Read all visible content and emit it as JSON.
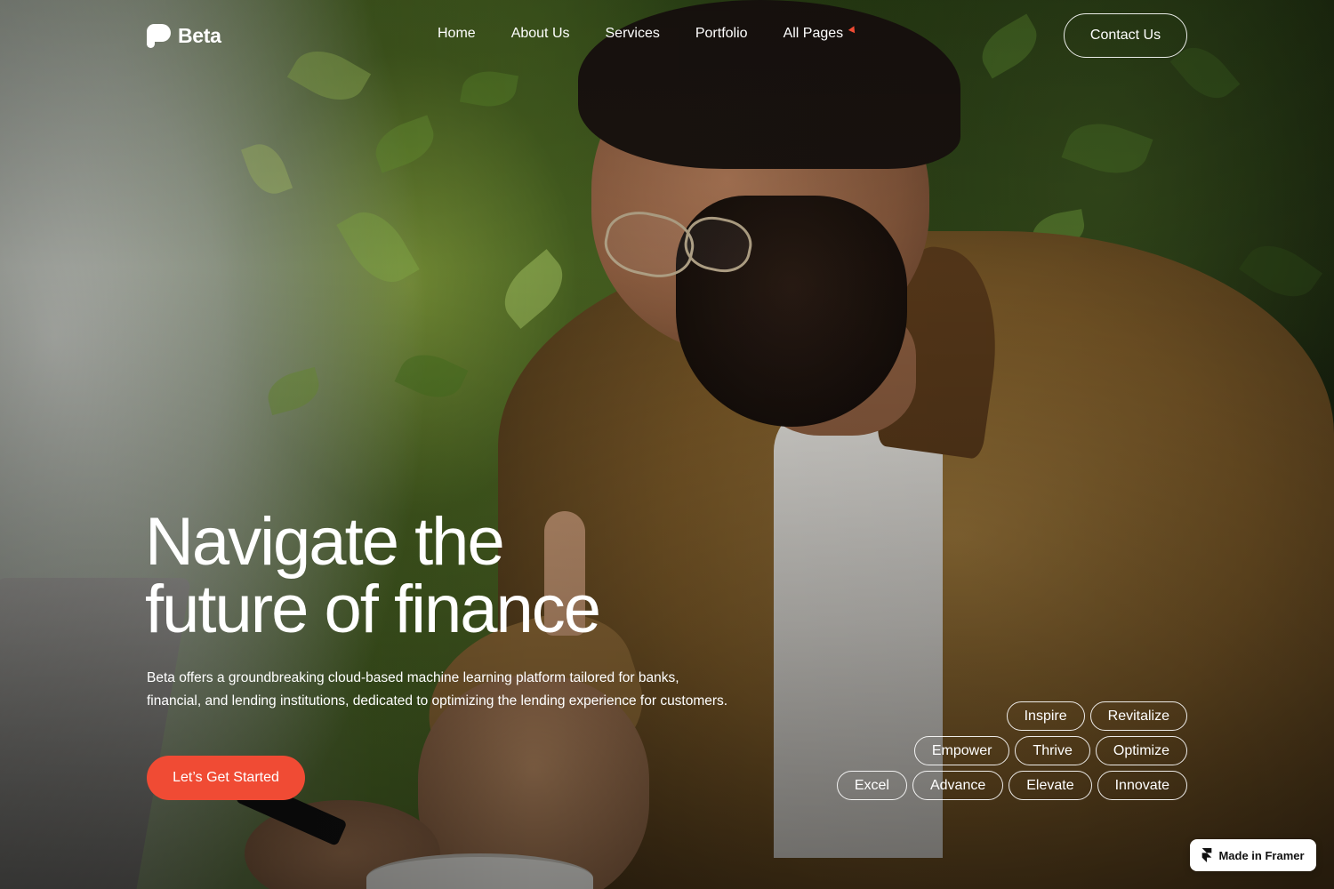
{
  "brand": {
    "name": "Beta",
    "logo_icon": "speech-bubble-logo-icon"
  },
  "nav": {
    "items": [
      {
        "label": "Home"
      },
      {
        "label": "About Us"
      },
      {
        "label": "Services"
      },
      {
        "label": "Portfolio"
      },
      {
        "label": "All Pages",
        "icon": "caret-down-icon"
      }
    ],
    "contact_label": "Contact Us"
  },
  "hero": {
    "title_line1": "Navigate the",
    "title_line2": "future of finance",
    "subtitle_line1": "Beta offers a groundbreaking cloud-based machine learning platform tailored for banks,",
    "subtitle_line2": "financial, and lending institutions, dedicated to optimizing the lending experience for customers.",
    "cta_label": "Let’s Get Started"
  },
  "tags": {
    "row1": [
      "Inspire",
      "Revitalize"
    ],
    "row2": [
      "Empower",
      "Thrive",
      "Optimize"
    ],
    "row3": [
      "Excel",
      "Advance",
      "Elevate",
      "Innovate"
    ]
  },
  "badge": {
    "label": "Made in Framer",
    "icon": "framer-icon"
  },
  "colors": {
    "accent": "#f04b34",
    "text": "#ffffff"
  }
}
